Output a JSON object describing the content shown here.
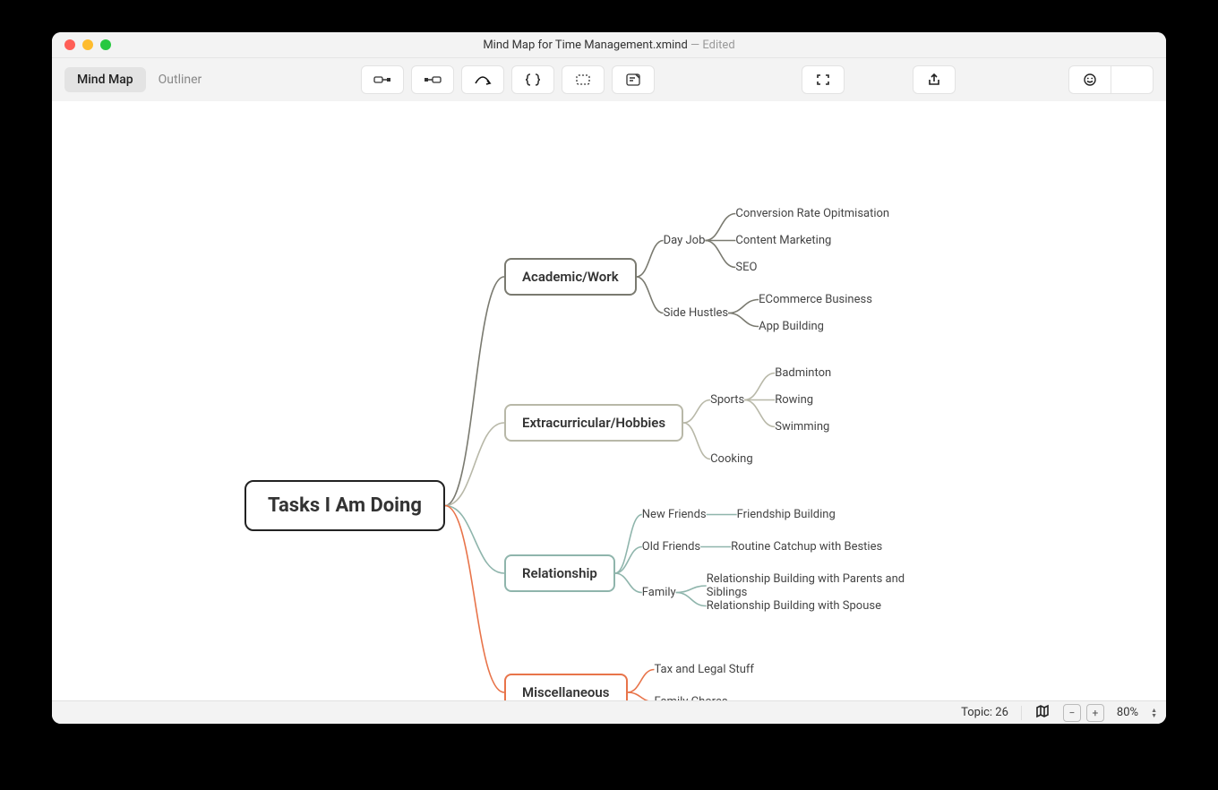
{
  "window": {
    "filename": "Mind Map for Time Management.xmind",
    "edited_suffix": " — Edited"
  },
  "toolbar": {
    "tabs": {
      "mindmap": "Mind Map",
      "outliner": "Outliner"
    }
  },
  "status": {
    "topic_label": "Topic: 26",
    "zoom": "80%"
  },
  "colors": {
    "c1": "#7a7a70",
    "c2": "#b8b8a8",
    "c3": "#8fb5ac",
    "c4": "#e8744a"
  },
  "map": {
    "central": "Tasks I Am Doing",
    "branches": [
      {
        "id": "b1",
        "label": "Academic/Work",
        "color": "c1",
        "children": [
          {
            "label": "Day Job",
            "children": [
              "Conversion Rate Opitmisation",
              "Content Marketing",
              "SEO"
            ]
          },
          {
            "label": "Side Hustles",
            "children": [
              "ECommerce Business",
              "App Building"
            ]
          }
        ]
      },
      {
        "id": "b2",
        "label": "Extracurricular/Hobbies",
        "color": "c2",
        "children": [
          {
            "label": "Sports",
            "children": [
              "Badminton",
              "Rowing",
              "Swimming"
            ]
          },
          {
            "label": "Cooking",
            "children": []
          }
        ]
      },
      {
        "id": "b3",
        "label": "Relationship",
        "color": "c3",
        "children": [
          {
            "label": "New Friends",
            "children": [
              "Friendship Building"
            ]
          },
          {
            "label": "Old Friends",
            "children": [
              "Routine Catchup with Besties"
            ]
          },
          {
            "label": "Family",
            "children": [
              "Relationship Building with Parents and Siblings",
              "Relationship Building with Spouse"
            ]
          }
        ]
      },
      {
        "id": "b4",
        "label": "Miscellaneous",
        "color": "c4",
        "children": [
          {
            "label": "Tax and Legal Stuff",
            "children": []
          },
          {
            "label": "Family Chores",
            "children": []
          }
        ]
      }
    ]
  }
}
